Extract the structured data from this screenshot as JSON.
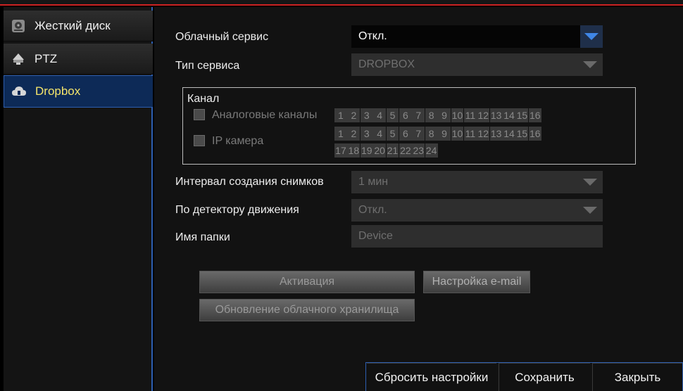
{
  "sidebar": {
    "items": [
      {
        "label": "Жесткий диск",
        "icon": "hard-disk-icon"
      },
      {
        "label": "PTZ",
        "icon": "ptz-camera-icon"
      },
      {
        "label": "Dropbox",
        "icon": "cloud-icon",
        "active": true
      }
    ]
  },
  "form": {
    "cloud_service_label": "Облачный сервис",
    "cloud_service_value": "Откл.",
    "service_type_label": "Тип сервиса",
    "service_type_value": "DROPBOX",
    "channel_title": "Канал",
    "analog_label": "Аналоговые каналы",
    "ip_label": "IP камера",
    "analog_channels": [
      "1",
      "2",
      "3",
      "4",
      "5",
      "6",
      "7",
      "8",
      "9",
      "10",
      "11",
      "12",
      "13",
      "14",
      "15",
      "16"
    ],
    "ip_channels_row1": [
      "1",
      "2",
      "3",
      "4",
      "5",
      "6",
      "7",
      "8",
      "9",
      "10",
      "11",
      "12",
      "13",
      "14",
      "15",
      "16"
    ],
    "ip_channels_row2": [
      "17",
      "18",
      "19",
      "20",
      "21",
      "22",
      "23",
      "24"
    ],
    "snapshot_interval_label": "Интервал создания снимков",
    "snapshot_interval_value": "1 мин",
    "motion_label": "По детектору движения",
    "motion_value": "Откл.",
    "folder_label": "Имя папки",
    "folder_value": "Device"
  },
  "buttons": {
    "activate": "Активация",
    "email_settings": "Настройка e-mail",
    "cloud_update": "Обновление облачного хранилища"
  },
  "footer": {
    "reset": "Сбросить настройки",
    "save": "Сохранить",
    "close": "Закрыть"
  },
  "colors": {
    "accent_blue": "#2d5eb0",
    "active_text": "#f5e56b",
    "top_red": "#cc2222"
  }
}
